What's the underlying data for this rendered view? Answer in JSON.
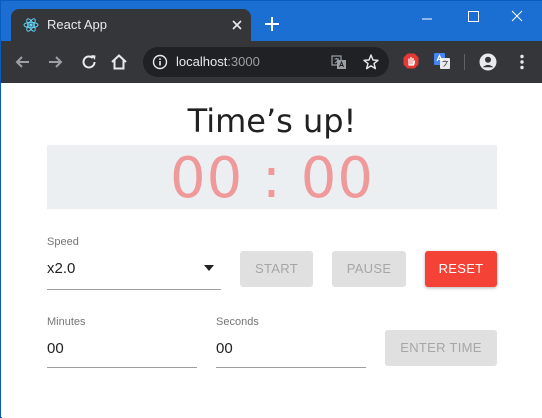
{
  "browser": {
    "tab_title": "React App",
    "url_host": "localhost",
    "url_port": ":3000",
    "icons": {
      "tab": "react-icon",
      "close": "close-icon",
      "new_tab": "plus-icon",
      "back": "arrow-left-icon",
      "forward": "arrow-right-icon",
      "reload": "reload-icon",
      "home": "home-icon",
      "info": "info-icon",
      "translate": "translate-icon",
      "star": "star-icon",
      "stop_ext": "hand-stop-icon",
      "translate_ext": "google-translate-icon",
      "profile": "account-icon",
      "menu": "kebab-menu-icon"
    },
    "colors": {
      "titlebar": "#1b6fd3",
      "toolbar": "#35363a",
      "omnibox": "#202124"
    }
  },
  "app": {
    "heading": "Time’s up!",
    "time_display": "00 : 00",
    "speed": {
      "label": "Speed",
      "value": "x2.0"
    },
    "buttons": {
      "start": "START",
      "pause": "PAUSE",
      "reset": "RESET",
      "enter_time": "ENTER TIME"
    },
    "minutes": {
      "label": "Minutes",
      "value": "00"
    },
    "seconds": {
      "label": "Seconds",
      "value": "00"
    },
    "colors": {
      "reset_button": "#f44336",
      "time_text": "#f0999a",
      "time_background": "#eceff2"
    }
  }
}
